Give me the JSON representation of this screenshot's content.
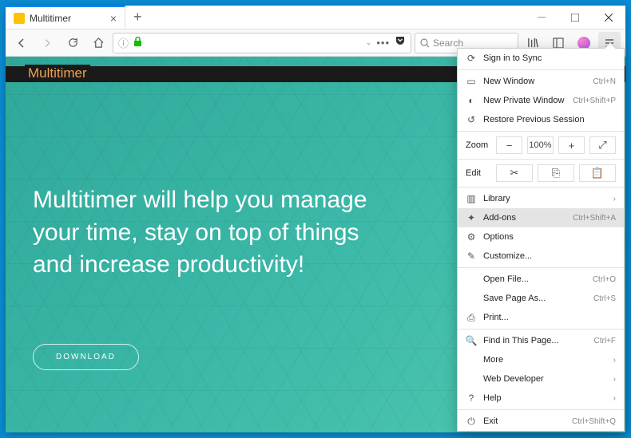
{
  "tab": {
    "title": "Multitimer"
  },
  "search": {
    "placeholder": "Search"
  },
  "page": {
    "brand": "Multitimer",
    "hero": "Multitimer will help you manage your time, stay on top of things and increase productivity!",
    "download": "DOWNLOAD"
  },
  "menu": {
    "sync": "Sign in to Sync",
    "newwin": {
      "label": "New Window",
      "key": "Ctrl+N"
    },
    "priv": {
      "label": "New Private Window",
      "key": "Ctrl+Shift+P"
    },
    "restore": "Restore Previous Session",
    "zoom": {
      "label": "Zoom",
      "value": "100%"
    },
    "edit": {
      "label": "Edit"
    },
    "library": "Library",
    "addons": {
      "label": "Add-ons",
      "key": "Ctrl+Shift+A"
    },
    "options": "Options",
    "customize": "Customize...",
    "open": {
      "label": "Open File...",
      "key": "Ctrl+O"
    },
    "save": {
      "label": "Save Page As...",
      "key": "Ctrl+S"
    },
    "print": "Print...",
    "find": {
      "label": "Find in This Page...",
      "key": "Ctrl+F"
    },
    "more": "More",
    "webdev": "Web Developer",
    "help": "Help",
    "exit": {
      "label": "Exit",
      "key": "Ctrl+Shift+Q"
    }
  }
}
